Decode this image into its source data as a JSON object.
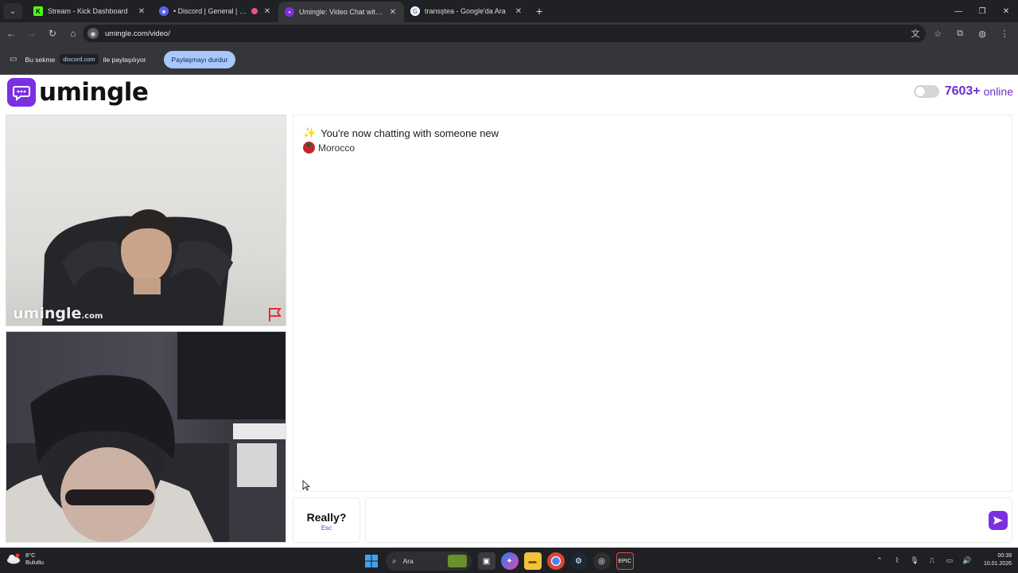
{
  "browser": {
    "tabs": [
      {
        "title": "Stream - Kick Dashboard",
        "favicon": "kick-icon",
        "active": false
      },
      {
        "title": "• Discord | General | Barış G",
        "favicon": "discord-icon",
        "active": false
      },
      {
        "title": "Umingle: Video Chat with S",
        "favicon": "umingle-icon",
        "active": true
      },
      {
        "title": "transştea - Google'da Ara",
        "favicon": "google-icon",
        "active": false
      }
    ],
    "url": "umingle.com/video/",
    "share_bar": {
      "prefix": "Bu sekme",
      "domain": "discord.com",
      "suffix": "ile paylaşılıyor",
      "stop_button": "Paylaşmayı durdur"
    }
  },
  "site": {
    "brand": "umingle",
    "online_count": "7603+",
    "online_label": "online",
    "accent_color": "#7b2fe0",
    "watermark_main": "umingle",
    "watermark_suffix": ".com"
  },
  "chat": {
    "system_message": "You're now chatting with someone new",
    "country": "Morocco"
  },
  "controls": {
    "esc_label": "Really?",
    "esc_hint": "Esc",
    "message_placeholder": ""
  },
  "taskbar": {
    "weather_temp": "8°C",
    "weather_desc": "Bulutlu",
    "search_label": "Ara",
    "time": "00:39",
    "date": "10.01.2026"
  }
}
